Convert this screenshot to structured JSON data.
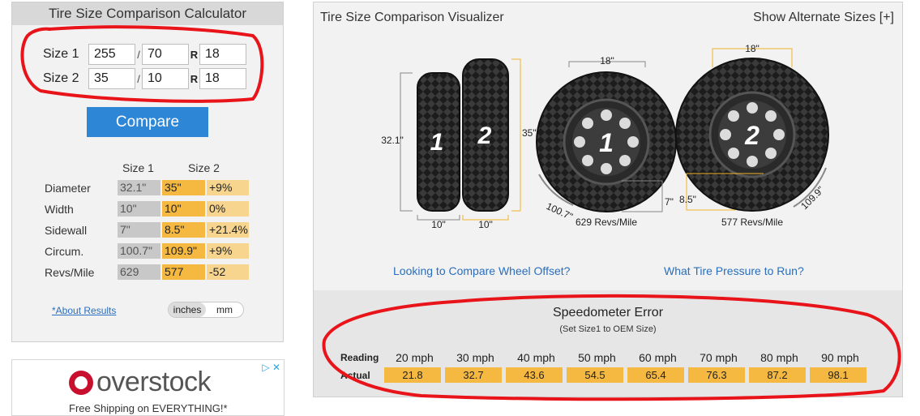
{
  "calculator": {
    "title": "Tire Size Comparison Calculator",
    "size1": {
      "label": "Size 1",
      "width": "255",
      "aspect": "70",
      "rim": "18"
    },
    "size2": {
      "label": "Size 2",
      "width": "35",
      "aspect": "10",
      "rim": "18"
    },
    "slash": "/",
    "r_label": "R",
    "compare_label": "Compare",
    "results": {
      "col1": "Size 1",
      "col2": "Size 2",
      "rows": [
        {
          "label": "Diameter",
          "v1": "32.1\"",
          "v2": "35\"",
          "diff": "+9%"
        },
        {
          "label": "Width",
          "v1": "10\"",
          "v2": "10\"",
          "diff": "0%"
        },
        {
          "label": "Sidewall",
          "v1": "7\"",
          "v2": "8.5\"",
          "diff": "+21.4%"
        },
        {
          "label": "Circum.",
          "v1": "100.7\"",
          "v2": "109.9\"",
          "diff": "+9%"
        },
        {
          "label": "Revs/Mile",
          "v1": "629",
          "v2": "577",
          "diff": "-52"
        }
      ]
    },
    "about_link": "*About Results",
    "units": {
      "inches": "inches",
      "mm": "mm",
      "active": "inches"
    }
  },
  "ad": {
    "brand": "overstock",
    "tagline": "Free Shipping on EVERYTHING!*",
    "adchoice": "▷ ✕"
  },
  "visualizer": {
    "title": "Tire Size Comparison Visualizer",
    "alt_sizes": "Show Alternate Sizes [+]",
    "side": {
      "dia1": "32.1\"",
      "dia2": "35\"",
      "width1": "10\"",
      "width2": "10\"",
      "num1": "1",
      "num2": "2"
    },
    "wheel1": {
      "rim": "18\"",
      "sidewall": "7\"",
      "circ": "100.7\"",
      "revs": "629 Revs/Mile",
      "num": "1"
    },
    "wheel2": {
      "rim": "18\"",
      "sidewall": "8.5\"",
      "circ": "109.9\"",
      "revs": "577 Revs/Mile",
      "num": "2"
    },
    "link_offset": "Looking to Compare Wheel Offset?",
    "link_pressure": "What Tire Pressure to Run?",
    "colors": {
      "tire": "#1a1a1a",
      "dim_line": "#f0b429",
      "gray_line": "#888888",
      "accent": "#2e86d6"
    }
  },
  "speedometer": {
    "title": "Speedometer Error",
    "subtitle": "(Set Size1 to OEM Size)",
    "reading_label": "Reading",
    "actual_label": "Actual",
    "readings": [
      "20 mph",
      "30 mph",
      "40 mph",
      "50 mph",
      "60 mph",
      "70 mph",
      "80 mph",
      "90 mph"
    ],
    "actuals": [
      "21.8",
      "32.7",
      "43.6",
      "54.5",
      "65.4",
      "76.3",
      "87.2",
      "98.1"
    ]
  }
}
